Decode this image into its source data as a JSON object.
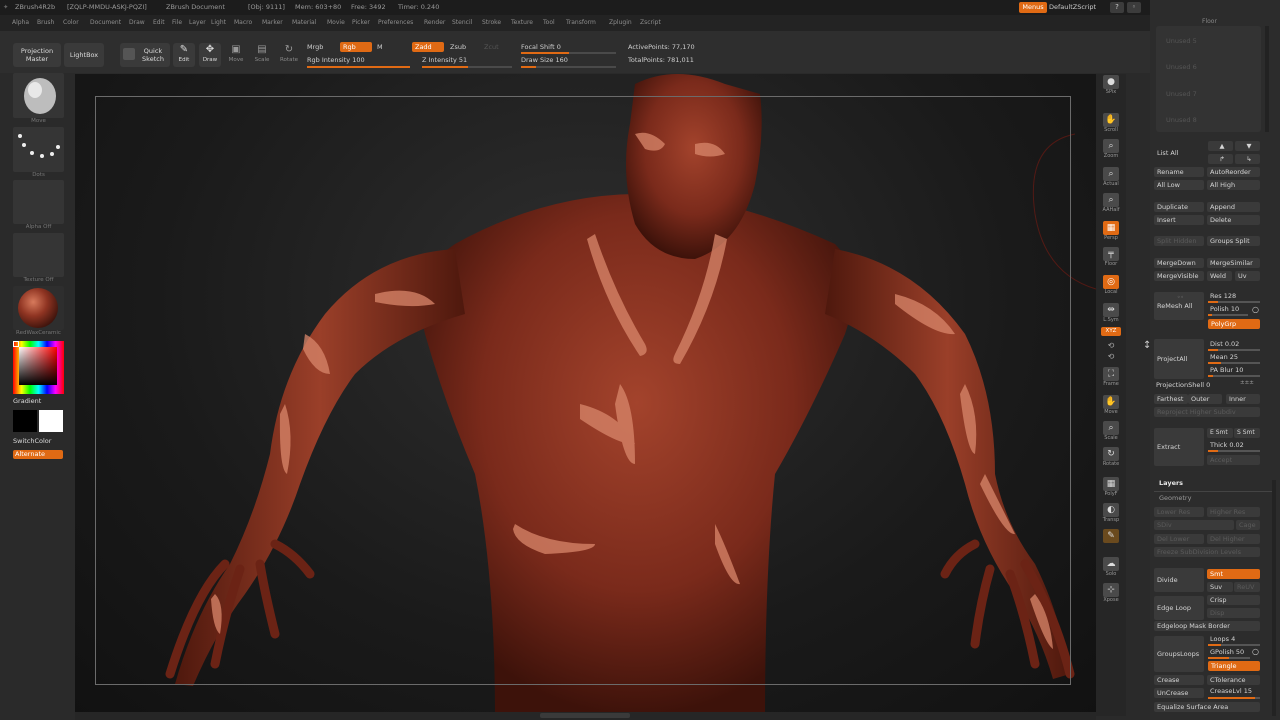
{
  "titlebar": {
    "app": "ZBrush4R2b",
    "session": "[ZQLP-MMDU-ASKJ-PQZI]",
    "document": "ZBrush Document",
    "obj": "[Obj: 9111]",
    "mem": "Mem: 603+80",
    "free": "Free: 3492",
    "timer": "Timer: 0.240",
    "menus_button": "Menus",
    "script": "DefaultZScript"
  },
  "menubar": [
    "Alpha",
    "Brush",
    "Color",
    "Document",
    "Draw",
    "Edit",
    "File",
    "Layer",
    "Light",
    "Macro",
    "Marker",
    "Material",
    "Movie",
    "Picker",
    "Preferences",
    "Render",
    "Stencil",
    "Stroke",
    "Texture",
    "Tool",
    "Transform",
    "Zplugin",
    "Zscript"
  ],
  "toolbar": {
    "projection_master": "Projection Master",
    "lightbox": "LightBox",
    "quick_sketch": "Quick Sketch",
    "edit": "Edit",
    "draw": "Draw",
    "move": "Move",
    "scale": "Scale",
    "rotate": "Rotate",
    "mrgb": "Mrgb",
    "rgb": "Rgb",
    "m": "M",
    "zadd": "Zadd",
    "zsub": "Zsub",
    "zcut": "Zcut",
    "rgb_intensity_label": "Rgb Intensity",
    "rgb_intensity": "100",
    "rgb_intensity_level": 1.0,
    "z_intensity_label": "Z Intensity",
    "z_intensity": "51",
    "z_intensity_level": 0.51,
    "focal_shift_label": "Focal Shift",
    "focal_shift": "0",
    "focal_shift_level": 0.5,
    "draw_size_label": "Draw Size",
    "draw_size": "160",
    "draw_size_level": 0.16,
    "active_points_label": "ActivePoints:",
    "active_points": "77,170",
    "total_points_label": "TotalPoints:",
    "total_points": "781,011"
  },
  "leftshelf": {
    "brush_label": "Move",
    "stroke_label": "Dots",
    "alpha_label": "Alpha Off",
    "texture_label": "Texture Off",
    "material_label": "RedWaxCeramic",
    "gradient": "Gradient",
    "switchcolor": "SwitchColor",
    "alternate": "Alternate",
    "colors": {
      "main": "#ff0000",
      "secondary": "#ffffff",
      "primary_swatch": "#000000"
    }
  },
  "righttools": [
    "SPix",
    "Scroll",
    "Zoom",
    "Actual",
    "AAHalf",
    "Persp",
    "Floor",
    "Local",
    "L.Sym",
    "XYZ",
    "Frame",
    "Move",
    "Scale",
    "Rotate",
    "PolyF",
    "Transp",
    "Ghost",
    "Solo",
    "Xpose"
  ],
  "rpanel": {
    "floor": "Floor",
    "subtools": [
      "Unused 5",
      "Unused 6",
      "Unused 7",
      "Unused 8"
    ],
    "list_all": "List All",
    "rename": "Rename",
    "autoreorder": "AutoReorder",
    "all_low": "All Low",
    "all_high": "All High",
    "duplicate": "Duplicate",
    "append": "Append",
    "insert": "Insert",
    "delete": "Delete",
    "split_hidden": "Split Hidden",
    "groups_split": "Groups Split",
    "mergedown": "MergeDown",
    "mergesimilar": "MergeSimilar",
    "mergevisible": "MergeVisible",
    "weld": "Weld",
    "uv": "Uv",
    "remesh_all": "ReMesh All",
    "res_label": "Res",
    "res": "128",
    "res_level": 0.2,
    "polish_label": "Polish",
    "polish": "10",
    "polish_level": 0.1,
    "polygrp": "PolyGrp",
    "projectall": "ProjectAll",
    "dist_label": "Dist",
    "dist": "0.02",
    "dist_level": 0.2,
    "mean_label": "Mean",
    "mean": "25",
    "mean_level": 0.25,
    "pablur_label": "PA Blur",
    "pablur": "10",
    "pablur_level": 0.1,
    "projectionshell": "ProjectionShell",
    "projectionshell_val": "0",
    "farthest": "Farthest",
    "outer": "Outer",
    "inner": "Inner",
    "reproject": "Reproject Higher Subdiv",
    "extract": "Extract",
    "e_smt": "E Smt",
    "s_smt": "S Smt",
    "thick_label": "Thick",
    "thick": "0.02",
    "thick_level": 0.2,
    "accept": "Accept",
    "layers": "Layers",
    "geometry": "Geometry",
    "lower_res": "Lower Res",
    "higher_res": "Higher Res",
    "sdiv": "SDiv",
    "cage": "Cage",
    "del_lower": "Del Lower",
    "del_higher": "Del Higher",
    "freeze": "Freeze SubDivision Levels",
    "divide": "Divide",
    "smt": "Smt",
    "suv": "Suv",
    "reuv": "ReUV",
    "crisp": "Crisp",
    "edge_loop": "Edge Loop",
    "disp": "Disp",
    "edgeloop_mask": "Edgeloop Mask Border",
    "loops_label": "Loops",
    "loops": "4",
    "loops_level": 0.25,
    "groupsloops": "GroupsLoops",
    "gpolish_label": "GPolish",
    "gpolish": "50",
    "gpolish_level": 0.5,
    "triangle": "Triangle",
    "crease": "Crease",
    "ctolerance": "CTolerance",
    "uncrease": "UnCrease",
    "creaselvl_label": "CreaseLvl",
    "creaselvl": "15",
    "creaselvl_level": 0.9,
    "equalize": "Equalize Surface Area"
  }
}
